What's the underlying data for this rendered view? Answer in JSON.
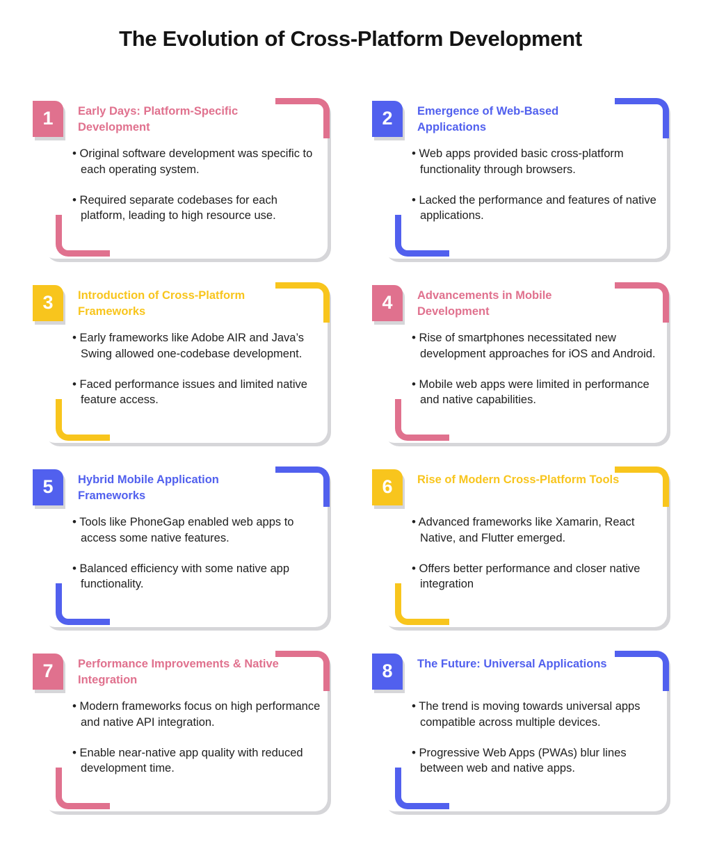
{
  "header": {
    "title": "The Evolution of Cross-Platform Development"
  },
  "colors": {
    "pink": "#e0718e",
    "blue": "#5160ee",
    "yellow": "#f8c51d",
    "text": "#202020",
    "title": "#141414",
    "shadow": "#d6d6d9",
    "background": "#ffffff"
  },
  "bullet_glyph": "•",
  "cards": [
    {
      "number": "1",
      "accent": "#e0718e",
      "heading": "Early Days: Platform-Specific Development",
      "bullets": [
        "Original software development was specific to each operating system.",
        "Required separate codebases for each platform, leading to high resource use."
      ]
    },
    {
      "number": "2",
      "accent": "#5160ee",
      "heading": "Emergence of Web-Based Applications",
      "bullets": [
        "Web apps provided basic cross-platform functionality through browsers.",
        "Lacked the performance and features of native applications."
      ]
    },
    {
      "number": "3",
      "accent": "#f8c51d",
      "heading": "Introduction of Cross-Platform Frameworks",
      "bullets": [
        "Early frameworks like Adobe AIR and Java’s Swing allowed one-codebase development.",
        "Faced performance issues and limited native feature access."
      ]
    },
    {
      "number": "4",
      "accent": "#e0718e",
      "heading": "Advancements in Mobile Development",
      "bullets": [
        "Rise of smartphones necessitated new development approaches for iOS and Android.",
        "Mobile web apps were limited in performance and native capabilities."
      ]
    },
    {
      "number": "5",
      "accent": "#5160ee",
      "heading": "Hybrid Mobile Application Frameworks",
      "bullets": [
        "Tools like PhoneGap enabled web apps to access some native features.",
        "Balanced efficiency with some native app functionality."
      ]
    },
    {
      "number": "6",
      "accent": "#f8c51d",
      "heading": "Rise of Modern Cross-Platform Tools",
      "bullets": [
        "Advanced frameworks like Xamarin, React Native, and Flutter emerged.",
        "Offers better performance and closer native integration"
      ]
    },
    {
      "number": "7",
      "accent": "#e0718e",
      "heading": "Performance Improvements & Native Integration",
      "bullets": [
        "Modern frameworks focus on high performance and native API integration.",
        "Enable near-native app quality with reduced development time."
      ]
    },
    {
      "number": "8",
      "accent": "#5160ee",
      "heading": "The Future: Universal Applications",
      "bullets": [
        "The trend is moving towards universal apps compatible across multiple devices.",
        "Progressive Web Apps (PWAs) blur lines between web and native apps."
      ]
    }
  ]
}
